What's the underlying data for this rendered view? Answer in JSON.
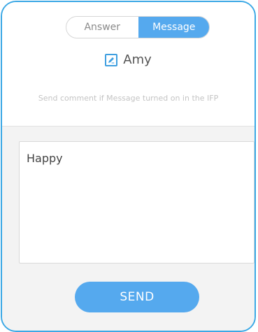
{
  "tabs": {
    "answer_label": "Answer",
    "message_label": "Message",
    "active": "Message"
  },
  "user": {
    "name": "Amy",
    "icon": "edit-icon"
  },
  "hint_text": "Send comment if Message turned on in the IFP",
  "message": {
    "value": "Happy"
  },
  "send_label": "SEND",
  "colors": {
    "accent": "#55a9ee",
    "frame_border": "#3ba8e5",
    "panel_bg": "#f3f3f3"
  }
}
